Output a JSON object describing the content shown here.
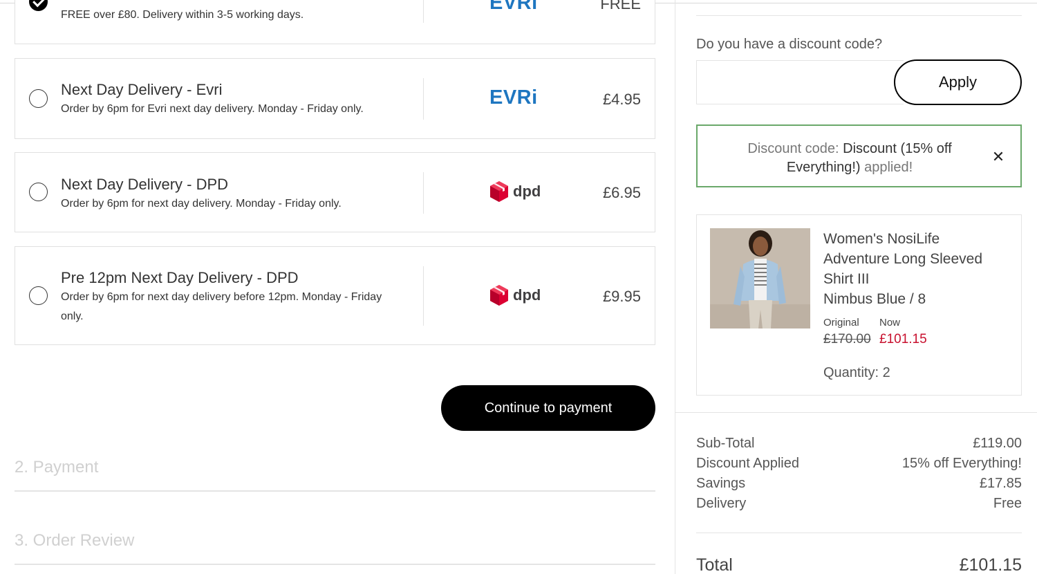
{
  "delivery_options": [
    {
      "title": "",
      "description": "FREE over £80. Delivery within 3-5 working days.",
      "carrier": "EVRi",
      "price": "FREE",
      "selected": true
    },
    {
      "title": "Next Day Delivery - Evri",
      "description": "Order by 6pm for Evri next day delivery. Monday - Friday only.",
      "carrier": "EVRi",
      "price": "£4.95",
      "selected": false
    },
    {
      "title": "Next Day Delivery - DPD",
      "description": "Order by 6pm for next day delivery. Monday - Friday only.",
      "carrier": "dpd",
      "price": "£6.95",
      "selected": false
    },
    {
      "title": "Pre 12pm Next Day Delivery - DPD",
      "description": "Order by 6pm for next day delivery before 12pm. Monday - Friday only.",
      "carrier": "dpd",
      "price": "£9.95",
      "selected": false
    }
  ],
  "continue_label": "Continue to payment",
  "steps": {
    "payment": "2. Payment",
    "review": "3. Order Review"
  },
  "discount": {
    "label": "Do you have a discount code?",
    "input_value": "",
    "apply_label": "Apply",
    "applied_prefix": "Discount code:",
    "applied_code": "Discount (15% off Everything!)",
    "applied_suffix": "applied!",
    "close_icon": "close-icon"
  },
  "product": {
    "name": "Women's NosiLife Adventure Long Sleeved Shirt III",
    "variant": "Nimbus Blue / 8",
    "original_label": "Original",
    "now_label": "Now",
    "original_price": "£170.00",
    "now_price": "£101.15",
    "quantity": "Quantity: 2"
  },
  "summary": {
    "subtotal_label": "Sub-Total",
    "subtotal": "£119.00",
    "discount_label": "Discount Applied",
    "discount": "15% off Everything!",
    "savings_label": "Savings",
    "savings": "£17.85",
    "delivery_label": "Delivery",
    "delivery": "Free",
    "total_label": "Total",
    "total": "£101.15"
  },
  "colors": {
    "evri": "#1e76c0",
    "dpd": "#dc0032",
    "sale": "#c8102e",
    "applied_border": "#6aa86a"
  }
}
